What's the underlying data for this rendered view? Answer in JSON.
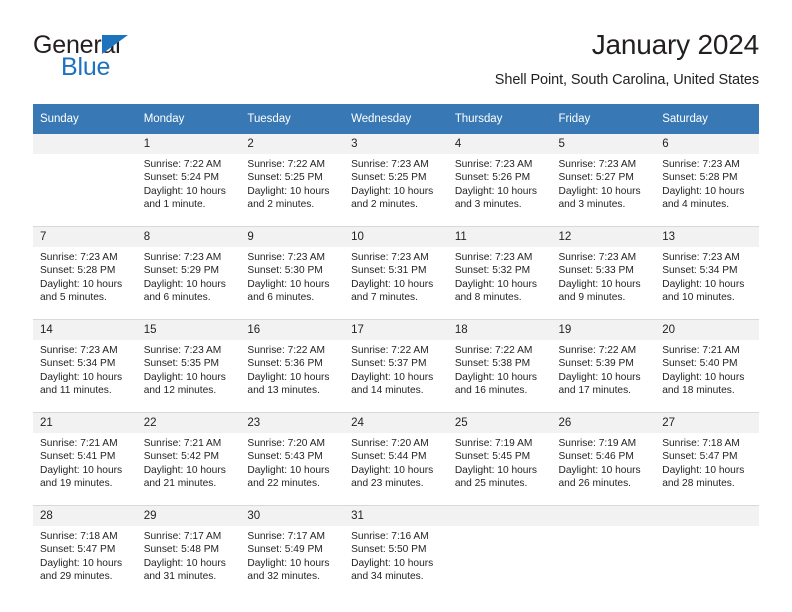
{
  "brand": {
    "name_part1": "General",
    "name_part2": "Blue",
    "color_primary": "#1e73be",
    "icon": "triangle-logo-icon"
  },
  "header": {
    "title": "January 2024",
    "subtitle": "Shell Point, South Carolina, United States"
  },
  "calendar": {
    "header_bg": "#3778b5",
    "daynum_bg": "#f2f2f2",
    "weekdays": [
      "Sunday",
      "Monday",
      "Tuesday",
      "Wednesday",
      "Thursday",
      "Friday",
      "Saturday"
    ],
    "weeks": [
      [
        {
          "day": "",
          "sunrise": "",
          "sunset": "",
          "daylight1": "",
          "daylight2": ""
        },
        {
          "day": "1",
          "sunrise": "Sunrise: 7:22 AM",
          "sunset": "Sunset: 5:24 PM",
          "daylight1": "Daylight: 10 hours",
          "daylight2": "and 1 minute."
        },
        {
          "day": "2",
          "sunrise": "Sunrise: 7:22 AM",
          "sunset": "Sunset: 5:25 PM",
          "daylight1": "Daylight: 10 hours",
          "daylight2": "and 2 minutes."
        },
        {
          "day": "3",
          "sunrise": "Sunrise: 7:23 AM",
          "sunset": "Sunset: 5:25 PM",
          "daylight1": "Daylight: 10 hours",
          "daylight2": "and 2 minutes."
        },
        {
          "day": "4",
          "sunrise": "Sunrise: 7:23 AM",
          "sunset": "Sunset: 5:26 PM",
          "daylight1": "Daylight: 10 hours",
          "daylight2": "and 3 minutes."
        },
        {
          "day": "5",
          "sunrise": "Sunrise: 7:23 AM",
          "sunset": "Sunset: 5:27 PM",
          "daylight1": "Daylight: 10 hours",
          "daylight2": "and 3 minutes."
        },
        {
          "day": "6",
          "sunrise": "Sunrise: 7:23 AM",
          "sunset": "Sunset: 5:28 PM",
          "daylight1": "Daylight: 10 hours",
          "daylight2": "and 4 minutes."
        }
      ],
      [
        {
          "day": "7",
          "sunrise": "Sunrise: 7:23 AM",
          "sunset": "Sunset: 5:28 PM",
          "daylight1": "Daylight: 10 hours",
          "daylight2": "and 5 minutes."
        },
        {
          "day": "8",
          "sunrise": "Sunrise: 7:23 AM",
          "sunset": "Sunset: 5:29 PM",
          "daylight1": "Daylight: 10 hours",
          "daylight2": "and 6 minutes."
        },
        {
          "day": "9",
          "sunrise": "Sunrise: 7:23 AM",
          "sunset": "Sunset: 5:30 PM",
          "daylight1": "Daylight: 10 hours",
          "daylight2": "and 6 minutes."
        },
        {
          "day": "10",
          "sunrise": "Sunrise: 7:23 AM",
          "sunset": "Sunset: 5:31 PM",
          "daylight1": "Daylight: 10 hours",
          "daylight2": "and 7 minutes."
        },
        {
          "day": "11",
          "sunrise": "Sunrise: 7:23 AM",
          "sunset": "Sunset: 5:32 PM",
          "daylight1": "Daylight: 10 hours",
          "daylight2": "and 8 minutes."
        },
        {
          "day": "12",
          "sunrise": "Sunrise: 7:23 AM",
          "sunset": "Sunset: 5:33 PM",
          "daylight1": "Daylight: 10 hours",
          "daylight2": "and 9 minutes."
        },
        {
          "day": "13",
          "sunrise": "Sunrise: 7:23 AM",
          "sunset": "Sunset: 5:34 PM",
          "daylight1": "Daylight: 10 hours",
          "daylight2": "and 10 minutes."
        }
      ],
      [
        {
          "day": "14",
          "sunrise": "Sunrise: 7:23 AM",
          "sunset": "Sunset: 5:34 PM",
          "daylight1": "Daylight: 10 hours",
          "daylight2": "and 11 minutes."
        },
        {
          "day": "15",
          "sunrise": "Sunrise: 7:23 AM",
          "sunset": "Sunset: 5:35 PM",
          "daylight1": "Daylight: 10 hours",
          "daylight2": "and 12 minutes."
        },
        {
          "day": "16",
          "sunrise": "Sunrise: 7:22 AM",
          "sunset": "Sunset: 5:36 PM",
          "daylight1": "Daylight: 10 hours",
          "daylight2": "and 13 minutes."
        },
        {
          "day": "17",
          "sunrise": "Sunrise: 7:22 AM",
          "sunset": "Sunset: 5:37 PM",
          "daylight1": "Daylight: 10 hours",
          "daylight2": "and 14 minutes."
        },
        {
          "day": "18",
          "sunrise": "Sunrise: 7:22 AM",
          "sunset": "Sunset: 5:38 PM",
          "daylight1": "Daylight: 10 hours",
          "daylight2": "and 16 minutes."
        },
        {
          "day": "19",
          "sunrise": "Sunrise: 7:22 AM",
          "sunset": "Sunset: 5:39 PM",
          "daylight1": "Daylight: 10 hours",
          "daylight2": "and 17 minutes."
        },
        {
          "day": "20",
          "sunrise": "Sunrise: 7:21 AM",
          "sunset": "Sunset: 5:40 PM",
          "daylight1": "Daylight: 10 hours",
          "daylight2": "and 18 minutes."
        }
      ],
      [
        {
          "day": "21",
          "sunrise": "Sunrise: 7:21 AM",
          "sunset": "Sunset: 5:41 PM",
          "daylight1": "Daylight: 10 hours",
          "daylight2": "and 19 minutes."
        },
        {
          "day": "22",
          "sunrise": "Sunrise: 7:21 AM",
          "sunset": "Sunset: 5:42 PM",
          "daylight1": "Daylight: 10 hours",
          "daylight2": "and 21 minutes."
        },
        {
          "day": "23",
          "sunrise": "Sunrise: 7:20 AM",
          "sunset": "Sunset: 5:43 PM",
          "daylight1": "Daylight: 10 hours",
          "daylight2": "and 22 minutes."
        },
        {
          "day": "24",
          "sunrise": "Sunrise: 7:20 AM",
          "sunset": "Sunset: 5:44 PM",
          "daylight1": "Daylight: 10 hours",
          "daylight2": "and 23 minutes."
        },
        {
          "day": "25",
          "sunrise": "Sunrise: 7:19 AM",
          "sunset": "Sunset: 5:45 PM",
          "daylight1": "Daylight: 10 hours",
          "daylight2": "and 25 minutes."
        },
        {
          "day": "26",
          "sunrise": "Sunrise: 7:19 AM",
          "sunset": "Sunset: 5:46 PM",
          "daylight1": "Daylight: 10 hours",
          "daylight2": "and 26 minutes."
        },
        {
          "day": "27",
          "sunrise": "Sunrise: 7:18 AM",
          "sunset": "Sunset: 5:47 PM",
          "daylight1": "Daylight: 10 hours",
          "daylight2": "and 28 minutes."
        }
      ],
      [
        {
          "day": "28",
          "sunrise": "Sunrise: 7:18 AM",
          "sunset": "Sunset: 5:47 PM",
          "daylight1": "Daylight: 10 hours",
          "daylight2": "and 29 minutes."
        },
        {
          "day": "29",
          "sunrise": "Sunrise: 7:17 AM",
          "sunset": "Sunset: 5:48 PM",
          "daylight1": "Daylight: 10 hours",
          "daylight2": "and 31 minutes."
        },
        {
          "day": "30",
          "sunrise": "Sunrise: 7:17 AM",
          "sunset": "Sunset: 5:49 PM",
          "daylight1": "Daylight: 10 hours",
          "daylight2": "and 32 minutes."
        },
        {
          "day": "31",
          "sunrise": "Sunrise: 7:16 AM",
          "sunset": "Sunset: 5:50 PM",
          "daylight1": "Daylight: 10 hours",
          "daylight2": "and 34 minutes."
        },
        {
          "day": "",
          "sunrise": "",
          "sunset": "",
          "daylight1": "",
          "daylight2": ""
        },
        {
          "day": "",
          "sunrise": "",
          "sunset": "",
          "daylight1": "",
          "daylight2": ""
        },
        {
          "day": "",
          "sunrise": "",
          "sunset": "",
          "daylight1": "",
          "daylight2": ""
        }
      ]
    ]
  }
}
